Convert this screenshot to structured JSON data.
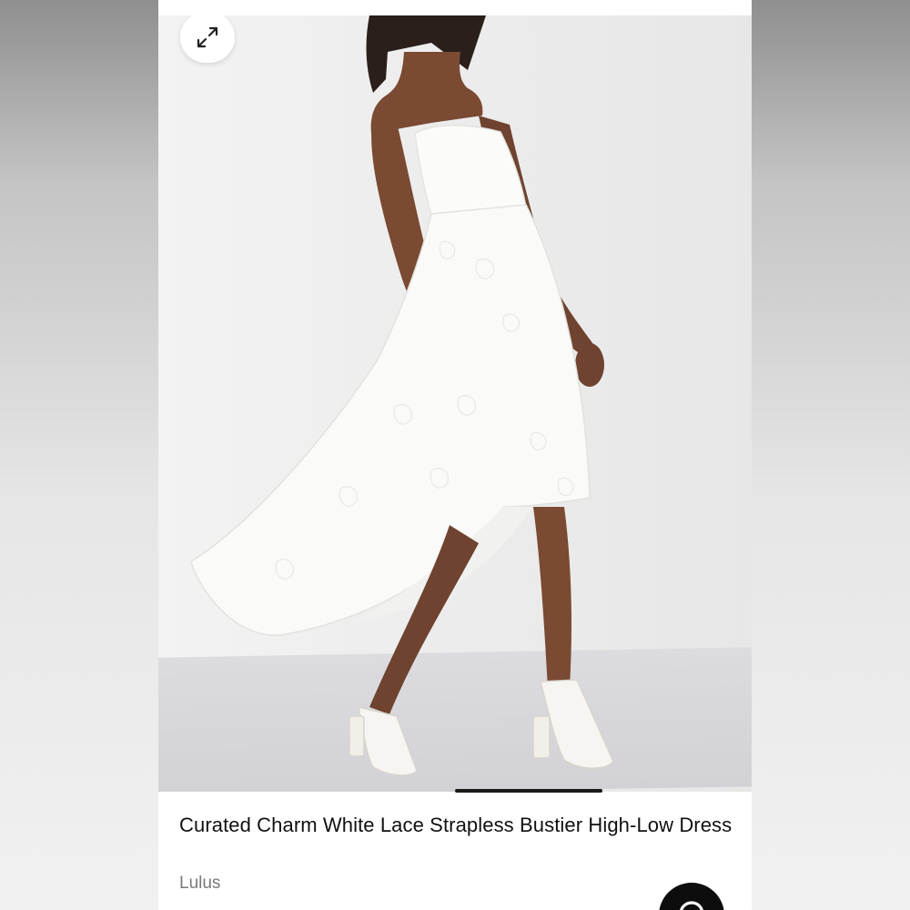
{
  "product": {
    "title": "Curated Charm White Lace Strapless Bustier High-Low Dress",
    "brand": "Lulus"
  },
  "gallery": {
    "image_subject": "model wearing white lace strapless high-low dress with white block heel sandals",
    "expand_icon": "expand-arrows-icon",
    "current_slide_indicator": "active"
  },
  "actions": {
    "fab_icon": "search-icon"
  },
  "colors": {
    "text_primary": "#111111",
    "text_secondary": "#7a7a7a",
    "fab_background": "#0d0d0d",
    "card_background": "#ffffff"
  }
}
